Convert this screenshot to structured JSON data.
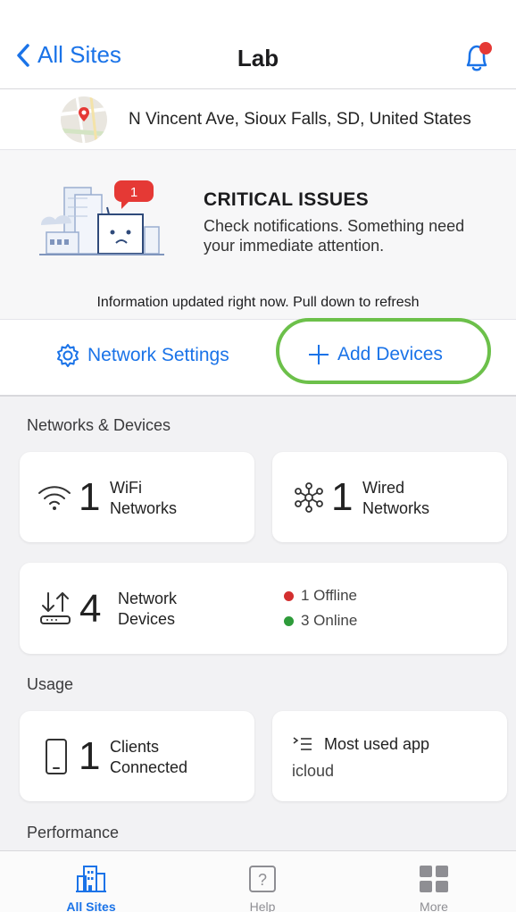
{
  "header": {
    "back_label": "All Sites",
    "title": "Lab",
    "bell_icon": "bell-alert-icon",
    "badge_color": "#e53935"
  },
  "location": {
    "address": "N Vincent Ave, Sioux Falls, SD, United States"
  },
  "issue": {
    "badge_count": "1",
    "title": "CRITICAL ISSUES",
    "message": "Check notifications. Something need your immediate attention."
  },
  "info_bar": "Information updated right now. Pull down to refresh",
  "actions": {
    "network_settings": "Network Settings",
    "add_devices": "Add Devices",
    "highlight_color": "#6cc04a"
  },
  "networks": {
    "section_title": "Networks & Devices",
    "wifi": {
      "count": "1",
      "line1": "WiFi",
      "line2": "Networks"
    },
    "wired": {
      "count": "1",
      "line1": "Wired",
      "line2": "Networks"
    },
    "devices": {
      "count": "4",
      "line1": "Network",
      "line2": "Devices",
      "offline": "1 Offline",
      "online": "3 Online",
      "offline_color": "#d32f2f",
      "online_color": "#2e9b3a"
    }
  },
  "usage": {
    "section_title": "Usage",
    "clients": {
      "count": "1",
      "line1": "Clients",
      "line2": "Connected"
    },
    "app": {
      "title": "Most used app",
      "value": "icloud"
    }
  },
  "performance": {
    "section_title": "Performance"
  },
  "tabs": [
    {
      "label": "All Sites",
      "icon": "buildings-icon",
      "active": true
    },
    {
      "label": "Help",
      "icon": "help-icon",
      "active": false
    },
    {
      "label": "More",
      "icon": "grid-icon",
      "active": false
    }
  ],
  "accent_color": "#1a73e8"
}
